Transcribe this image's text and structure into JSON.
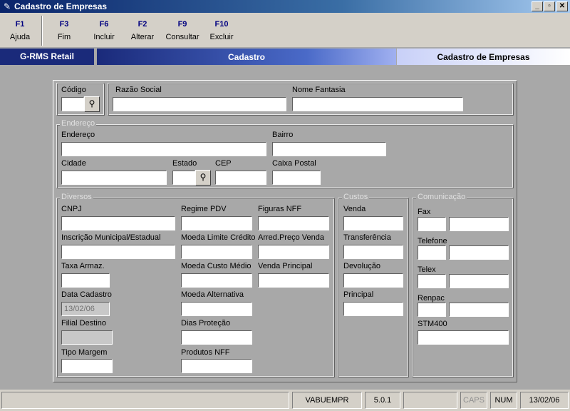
{
  "window": {
    "title": "Cadastro de Empresas",
    "icon": "pen-icon",
    "controls": {
      "minimize": "_",
      "maximize": "▫",
      "close": "✕"
    }
  },
  "fkeys": [
    {
      "key": "F1",
      "label": "Ajuda"
    },
    {
      "key": "F3",
      "label": "Fim"
    },
    {
      "key": "F6",
      "label": "Incluir"
    },
    {
      "key": "F2",
      "label": "Alterar"
    },
    {
      "key": "F9",
      "label": "Consultar"
    },
    {
      "key": "F10",
      "label": "Excluir"
    }
  ],
  "header": {
    "app": "G-RMS Retail",
    "section": "Cadastro",
    "screen": "Cadastro de Empresas"
  },
  "form": {
    "codigo": {
      "label": "Código",
      "value": ""
    },
    "razao_social": {
      "label": "Razão Social",
      "value": ""
    },
    "nome_fantasia": {
      "label": "Nome Fantasia",
      "value": ""
    },
    "endereco_group": {
      "title": "Endereço",
      "endereco": {
        "label": "Endereço",
        "value": ""
      },
      "bairro": {
        "label": "Bairro",
        "value": ""
      },
      "cidade": {
        "label": "Cidade",
        "value": ""
      },
      "estado": {
        "label": "Estado",
        "value": ""
      },
      "cep": {
        "label": "CEP",
        "value": ""
      },
      "caixa_postal": {
        "label": "Caixa Postal",
        "value": ""
      }
    },
    "diversos": {
      "title": "Diversos",
      "cnpj": {
        "label": "CNPJ",
        "value": ""
      },
      "inscricao": {
        "label": "Inscrição Municipal/Estadual",
        "value": ""
      },
      "taxa_armaz": {
        "label": "Taxa Armaz.",
        "value": ""
      },
      "data_cadastro": {
        "label": "Data Cadastro",
        "value": "13/02/06"
      },
      "filial_destino": {
        "label": "Filial Destino",
        "value": ""
      },
      "tipo_margem": {
        "label": "Tipo Margem",
        "value": ""
      },
      "regime_pdv": {
        "label": "Regime PDV",
        "value": ""
      },
      "moeda_limite": {
        "label": "Moeda Limite Crédito",
        "value": ""
      },
      "moeda_custo": {
        "label": "Moeda Custo Médio",
        "value": ""
      },
      "moeda_alternativa": {
        "label": "Moeda Alternativa",
        "value": ""
      },
      "dias_protecao": {
        "label": "Dias Proteção",
        "value": ""
      },
      "produtos_nff": {
        "label": "Produtos NFF",
        "value": ""
      },
      "figuras_nff": {
        "label": "Figuras NFF",
        "value": ""
      },
      "arred_preco": {
        "label": "Arred.Preço Venda",
        "value": ""
      },
      "venda_principal": {
        "label": "Venda Principal",
        "value": ""
      }
    },
    "custos": {
      "title": "Custos",
      "venda": {
        "label": "Venda",
        "value": ""
      },
      "transferencia": {
        "label": "Transferência",
        "value": ""
      },
      "devolucao": {
        "label": "Devolução",
        "value": ""
      },
      "principal": {
        "label": "Principal",
        "value": ""
      }
    },
    "comunicacao": {
      "title": "Comunicação",
      "fax": {
        "label": "Fax",
        "ddd": "",
        "number": ""
      },
      "telefone": {
        "label": "Telefone",
        "ddd": "",
        "number": ""
      },
      "telex": {
        "label": "Telex",
        "ddd": "",
        "number": ""
      },
      "renpac": {
        "label": "Renpac",
        "ddd": "",
        "number": ""
      },
      "stm400": {
        "label": "STM400",
        "value": ""
      }
    }
  },
  "lookup_icon": "binoculars-icon",
  "status": {
    "program": "VABUEMPR",
    "version": "5.0.1",
    "caps": "CAPS",
    "num": "NUM",
    "date": "13/02/06"
  }
}
